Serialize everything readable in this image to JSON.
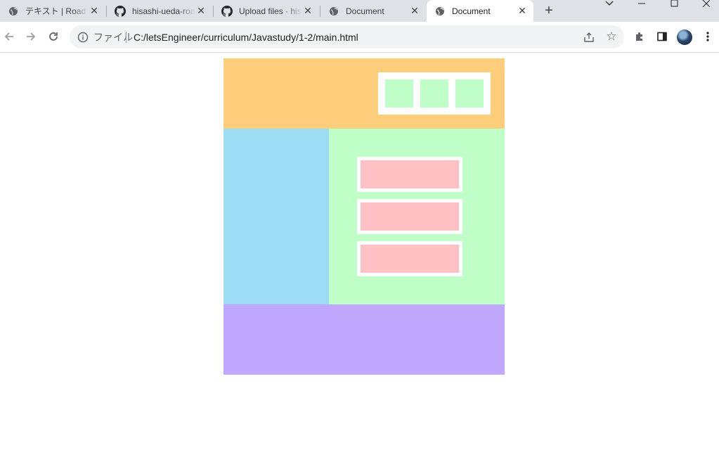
{
  "tabs": [
    {
      "title": "テキスト | Road To Engineer",
      "icon": "globe-icon",
      "active": false
    },
    {
      "title": "hisashi-ueda-road-to-engineer",
      "icon": "github-icon",
      "active": false
    },
    {
      "title": "Upload files · hisashi-ueda",
      "icon": "github-icon",
      "active": false
    },
    {
      "title": "Document",
      "icon": "globe-icon",
      "active": false
    },
    {
      "title": "Document",
      "icon": "globe-icon",
      "active": true
    }
  ],
  "address_bar": {
    "scheme_label": "ファイル",
    "url": "C:/letsEngineer/curriculum/Javastudy/1-2/main.html"
  },
  "colors": {
    "header": "#ffce7c",
    "header_boxes": "#c1ffc8",
    "sidebar": "#9ddcf3",
    "main": "#c1ffc8",
    "main_items": "#ffc1c4",
    "footer": "#c0a8ff"
  }
}
